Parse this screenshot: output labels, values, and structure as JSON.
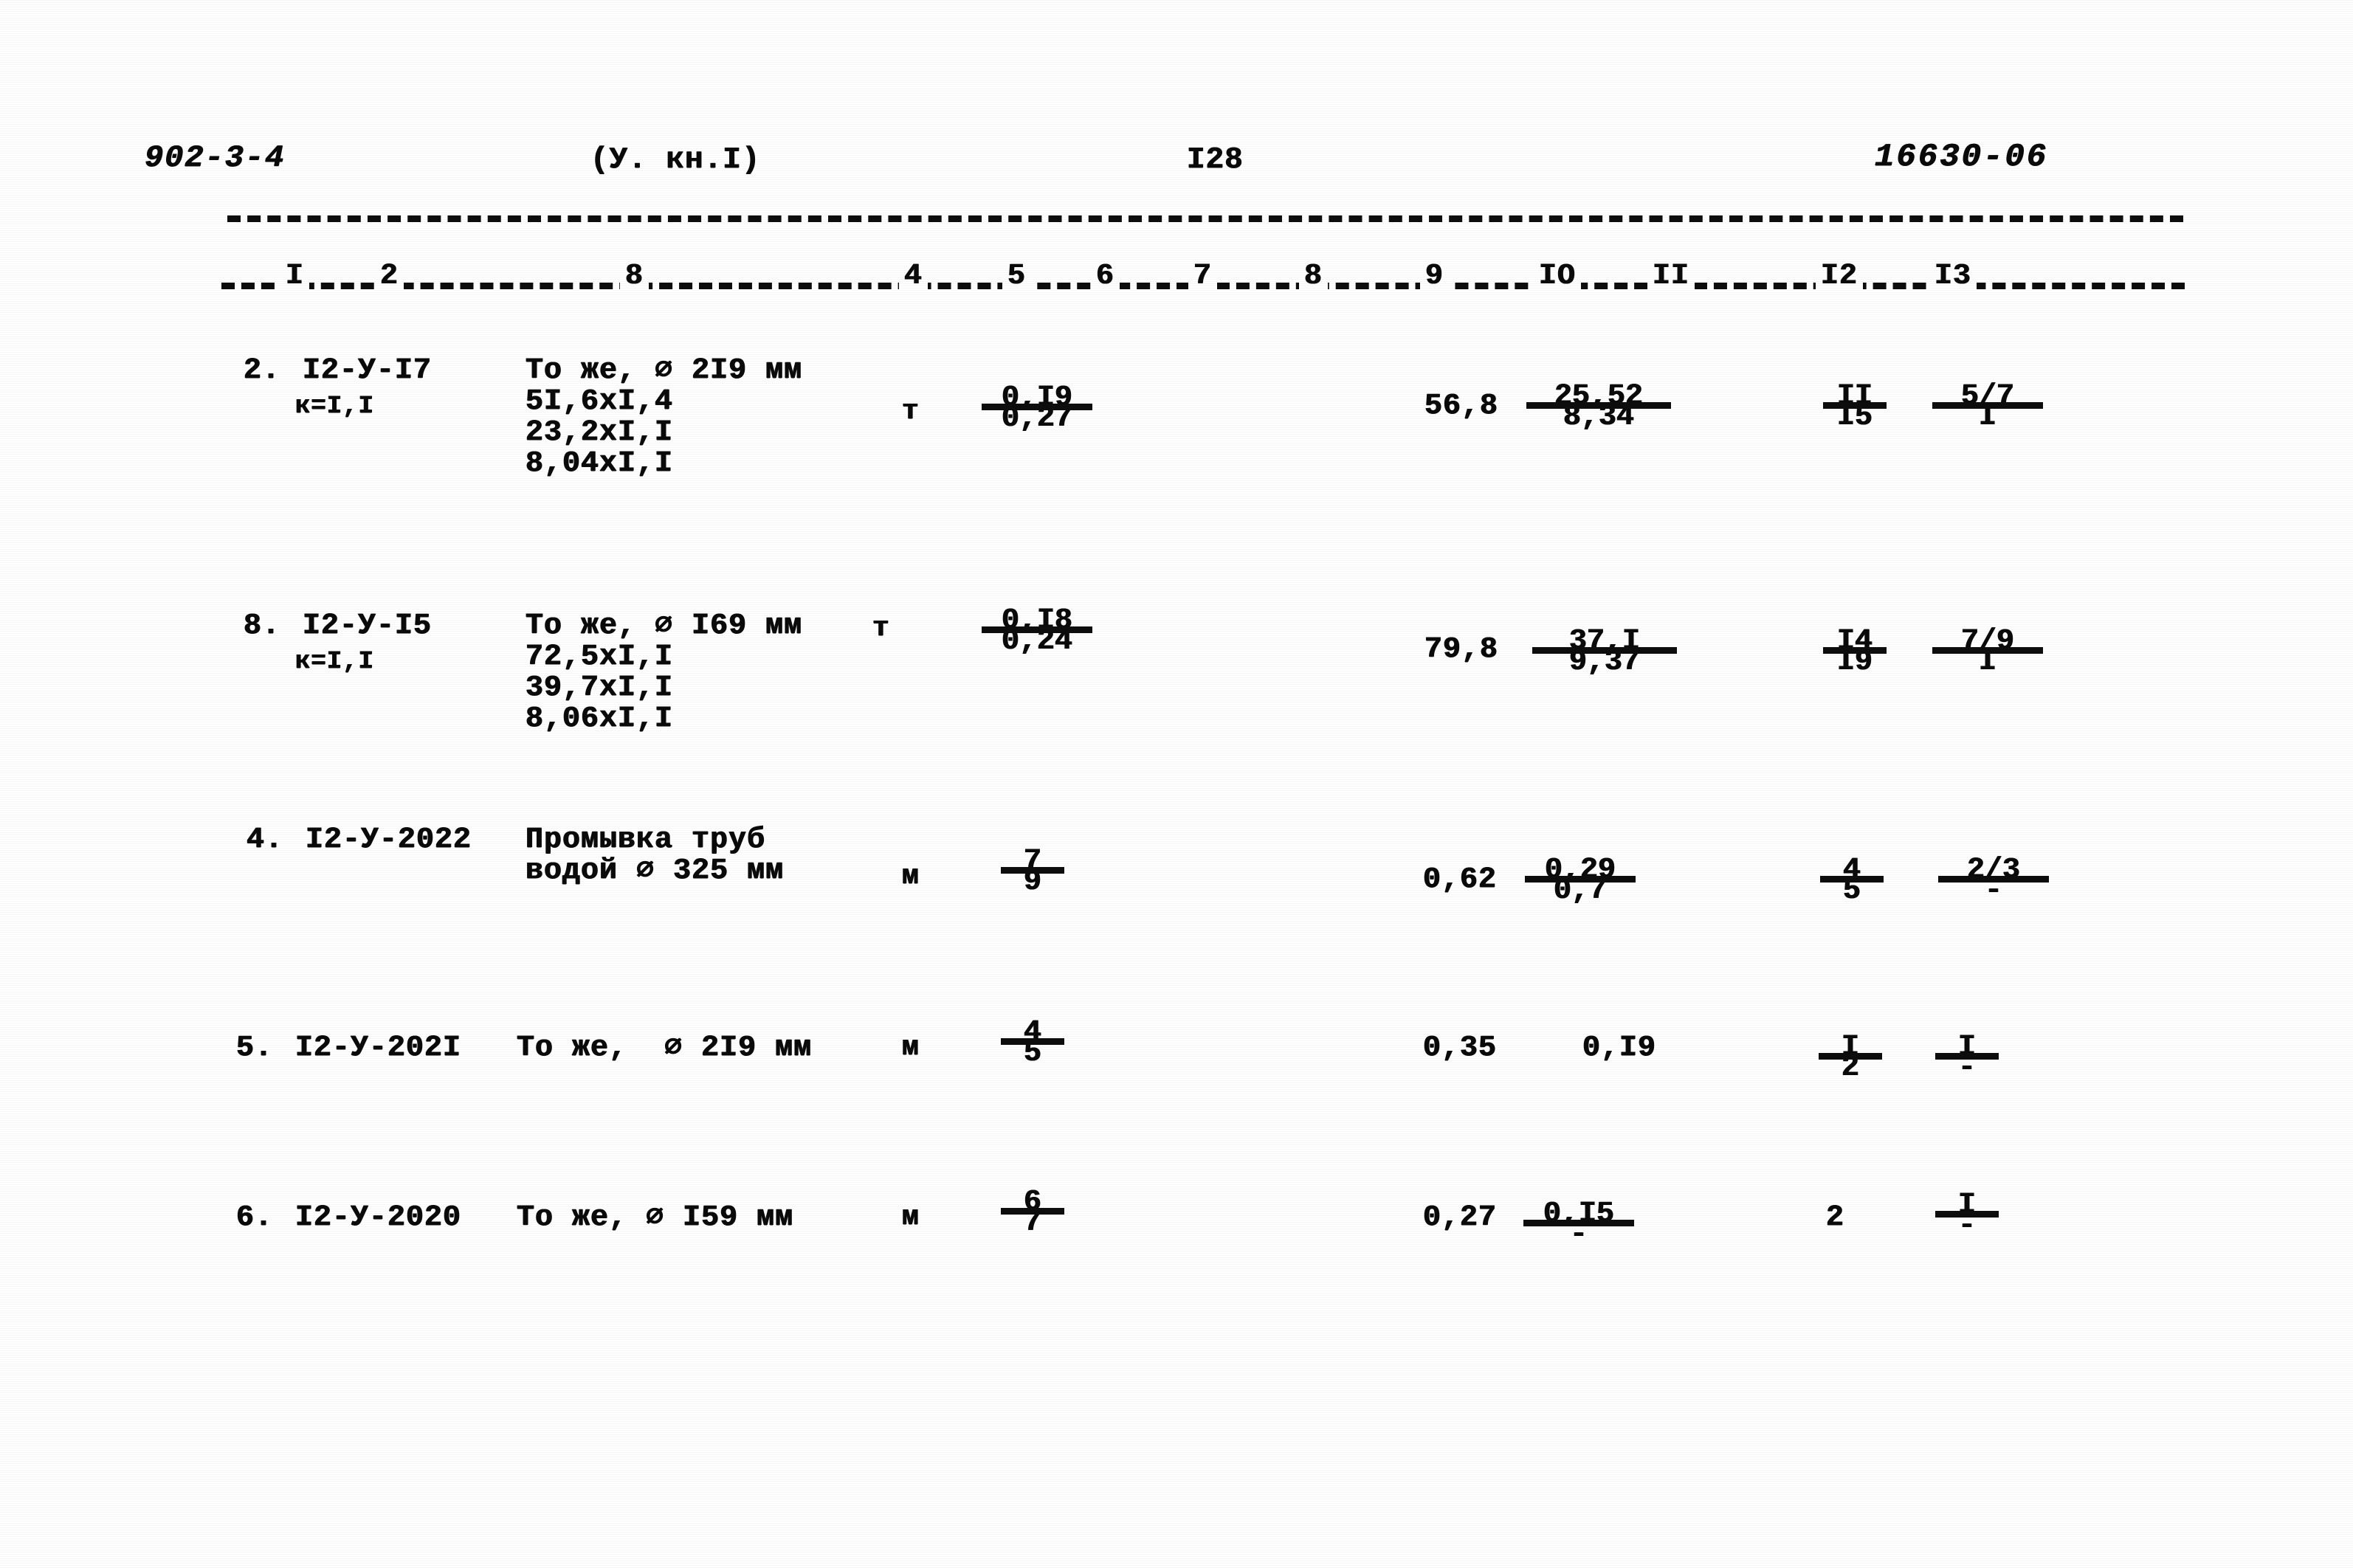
{
  "document": {
    "header": {
      "series_code": "902-3-4",
      "volume": "(У. кн.I)",
      "page_number": "I28",
      "sheet_code": "16630-06"
    },
    "column_numbers": [
      "I",
      "2",
      "8",
      "4",
      "5",
      "6",
      "7",
      "8",
      "9",
      "IO",
      "II",
      "I2",
      "I3"
    ],
    "rows": [
      {
        "number": "2.",
        "code": "I2-У-I7",
        "coefficient": "к=I,I",
        "description": "То же, ⌀ 2I9 мм\n5I,6xI,4\n23,2xI,I\n8,04xI,I",
        "unit": "т",
        "qty_num": "0,I9",
        "qty_den": "0,27",
        "col9": "56,8",
        "col10_num": "25,52",
        "col10_den": "8,34",
        "col12_num": "II",
        "col12_den": "I5",
        "col13_num": "5/7",
        "col13_den": "I"
      },
      {
        "number": "8.",
        "code": "I2-У-I5",
        "coefficient": "к=I,I",
        "description": "То же, ⌀ I69 мм\n72,5xI,I\n39,7xI,I\n8,06xI,I",
        "unit": "т",
        "qty_num": "0,I8",
        "qty_den": "0,24",
        "col9": "79,8",
        "col10_num": "37,I",
        "col10_den": "9,37",
        "col12_num": "I4",
        "col12_den": "I9",
        "col13_num": "7/9",
        "col13_den": "I"
      },
      {
        "number": "4.",
        "code": "I2-У-2022",
        "coefficient": "",
        "description": "Промывка труб\nводой ⌀ 325 мм",
        "unit": "м",
        "qty_num": "7",
        "qty_den": "9",
        "col9": "0,62",
        "col10_num": "0,29",
        "col10_den": "0,7",
        "col12_num": "4",
        "col12_den": "5",
        "col13_num": "2/3",
        "col13_den": "-"
      },
      {
        "number": "5.",
        "code": "I2-У-202I",
        "coefficient": "",
        "description": "То же,  ⌀ 2I9 мм",
        "unit": "м",
        "qty_num": "4",
        "qty_den": "5",
        "col9": "0,35",
        "col10_num": "0,I9",
        "col10_den": "",
        "col12_num": "I",
        "col12_den": "2",
        "col13_num": "I",
        "col13_den": "-"
      },
      {
        "number": "6.",
        "code": "I2-У-2020",
        "coefficient": "",
        "description": "То же, ⌀ I59 мм",
        "unit": "м",
        "qty_num": "6",
        "qty_den": "7",
        "col9": "0,27",
        "col10_num": "0,I5",
        "col10_den": "-",
        "col12_num": "2",
        "col12_den": "",
        "col13_num": "I",
        "col13_den": "-"
      }
    ]
  }
}
